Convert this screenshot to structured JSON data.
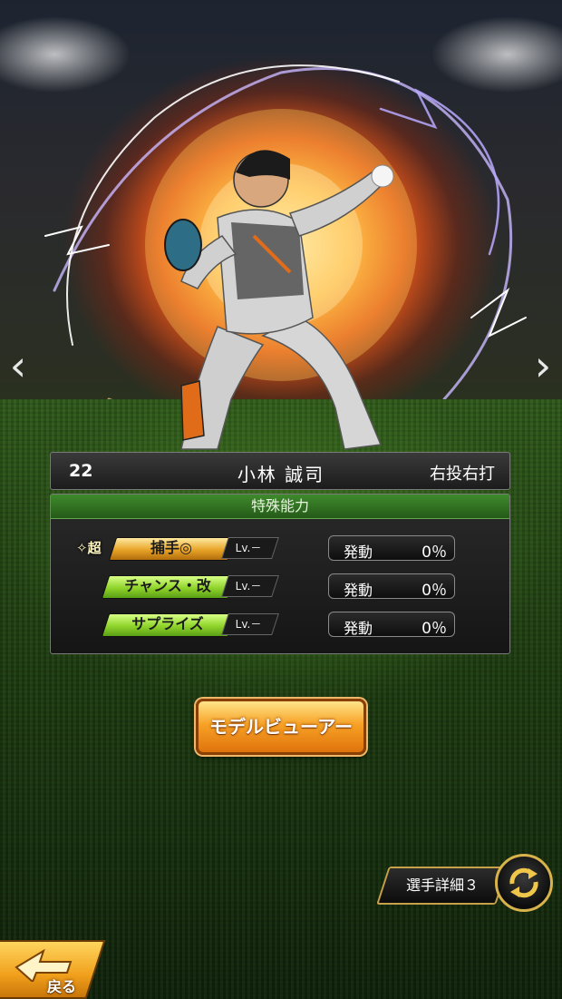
{
  "player": {
    "number": "22",
    "name": "小林 誠司",
    "throw_bat": "右投右打"
  },
  "abilities": {
    "header": "特殊能力",
    "super_mark": "✧超",
    "rows": [
      {
        "name": "捕手◎",
        "level": "Lv.－",
        "status_label": "発動",
        "status_value": "0％",
        "tier": "gold"
      },
      {
        "name": "チャンス・改",
        "level": "Lv.－",
        "status_label": "発動",
        "status_value": "0％",
        "tier": "green"
      },
      {
        "name": "サプライズ",
        "level": "Lv.－",
        "status_label": "発動",
        "status_value": "0％",
        "tier": "green"
      }
    ]
  },
  "buttons": {
    "model_viewer": "モデルビューアー",
    "player_detail": "選手詳細３",
    "back": "戻る"
  },
  "nav": {
    "prev": "‹",
    "next": "›"
  },
  "colors": {
    "accent_orange": "#f7a226",
    "ability_green": "#3f8a2c",
    "gold_tag": "#e7a326",
    "green_tag": "#8fd32a"
  }
}
